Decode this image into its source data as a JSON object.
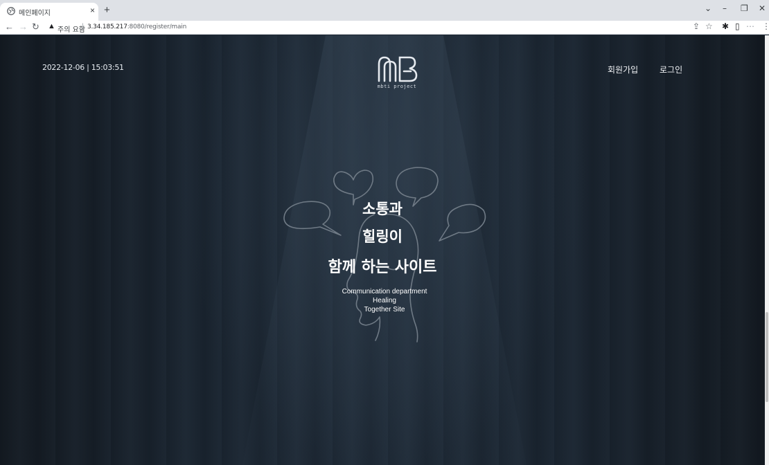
{
  "browser": {
    "tab_title": "메인페이지",
    "tab_close": "×",
    "new_tab": "+",
    "security_label": "주의 요함",
    "url_host": "3.34.185.217",
    "url_path": ":8080/register/main",
    "controls": {
      "dropdown": "⌄",
      "minimize": "–",
      "restore": "❐",
      "close": "✕"
    }
  },
  "header": {
    "datetime": "2022-12-06 | 15:03:51",
    "logo_tagline": "mbti project",
    "nav": {
      "signup": "회원가입",
      "login": "로그인"
    }
  },
  "hero": {
    "lines": [
      "소통과",
      "힐링이",
      "함께 하는 사이트"
    ],
    "sub_lines": [
      "Communication department",
      "Healing",
      "Together Site"
    ]
  }
}
